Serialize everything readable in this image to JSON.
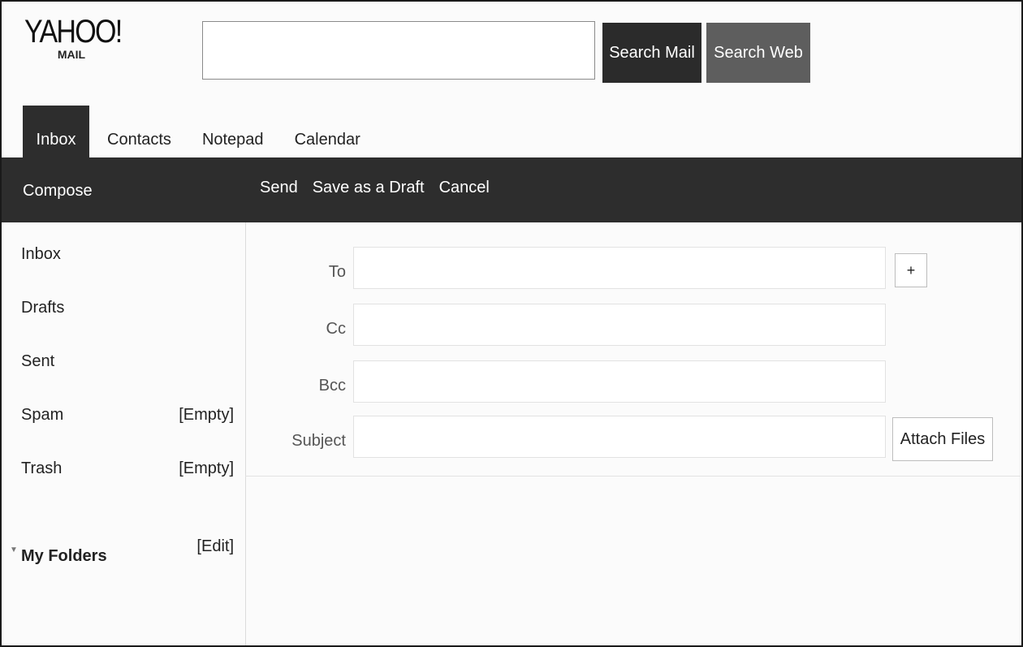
{
  "header": {
    "logo_text": "YAHOO!",
    "logo_sub": "MAIL",
    "search_value": "",
    "search_mail_label": "Search Mail",
    "search_web_label": "Search Web"
  },
  "tabs": [
    {
      "label": "Inbox",
      "active": true
    },
    {
      "label": "Contacts",
      "active": false
    },
    {
      "label": "Notepad",
      "active": false
    },
    {
      "label": "Calendar",
      "active": false
    }
  ],
  "toolbar": {
    "compose_label": "Compose",
    "send_label": "Send",
    "draft_label": "Save as a Draft",
    "cancel_label": "Cancel"
  },
  "sidebar": {
    "folders": [
      {
        "label": "Inbox",
        "action": ""
      },
      {
        "label": "Drafts",
        "action": ""
      },
      {
        "label": "Sent",
        "action": ""
      },
      {
        "label": "Spam",
        "action": "[Empty]"
      },
      {
        "label": "Trash",
        "action": "[Empty]"
      }
    ],
    "my_folders": {
      "label": "My Folders",
      "action": "[Edit]"
    }
  },
  "compose": {
    "to_label": "To",
    "cc_label": "Cc",
    "bcc_label": "Bcc",
    "subject_label": "Subject",
    "to_value": "",
    "cc_value": "",
    "bcc_value": "",
    "subject_value": "",
    "add_recipient_label": "+",
    "attach_label": "Attach Files"
  },
  "colors": {
    "toolbar_bg": "#2d2d2d",
    "search_mail_bg": "#2b2b2b",
    "search_web_bg": "#5e5e5e"
  }
}
